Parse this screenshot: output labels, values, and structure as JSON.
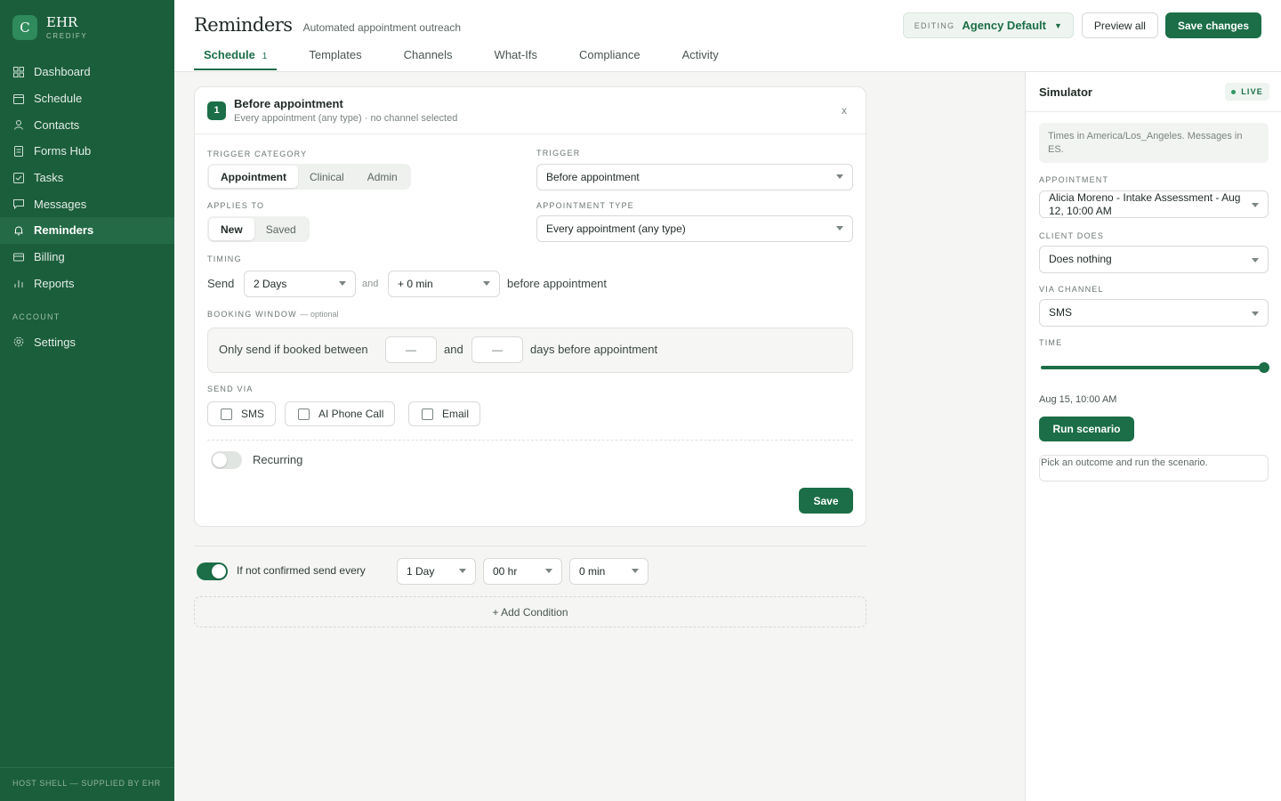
{
  "sidebar": {
    "logo_letter": "C",
    "brand_name": "EHR",
    "brand_sub": "CREDIFY",
    "items": [
      {
        "label": "Dashboard",
        "icon": "grid-icon"
      },
      {
        "label": "Schedule",
        "icon": "calendar-icon"
      },
      {
        "label": "Contacts",
        "icon": "person-icon"
      },
      {
        "label": "Forms Hub",
        "icon": "document-icon"
      },
      {
        "label": "Tasks",
        "icon": "checkbox-icon"
      },
      {
        "label": "Messages",
        "icon": "chat-icon"
      },
      {
        "label": "Reminders",
        "icon": "bell-icon",
        "active": true
      },
      {
        "label": "Billing",
        "icon": "card-icon"
      },
      {
        "label": "Reports",
        "icon": "bar-chart-icon"
      }
    ],
    "account_section": "ACCOUNT",
    "settings_label": "Settings",
    "footer": "HOST SHELL — SUPPLIED BY EHR"
  },
  "header": {
    "title": "Reminders",
    "subtitle": "Automated appointment outreach",
    "tabs": [
      {
        "label": "Schedule",
        "count": "1",
        "active": true
      },
      {
        "label": "Templates"
      },
      {
        "label": "Channels"
      },
      {
        "label": "What-Ifs"
      },
      {
        "label": "Compliance"
      },
      {
        "label": "Activity"
      }
    ],
    "editing_label": "EDITING",
    "editing_value": "Agency Default",
    "preview_label": "Preview all",
    "save_changes_label": "Save changes"
  },
  "rule": {
    "step": "1",
    "title": "Before appointment",
    "subtitle": "Every appointment (any type) · no channel selected",
    "close": "x",
    "trigger_category_label": "TRIGGER CATEGORY",
    "trigger_categories": [
      "Appointment",
      "Clinical",
      "Admin"
    ],
    "trigger_label": "TRIGGER",
    "trigger_value": "Before appointment",
    "applies_to_label": "APPLIES TO",
    "applies_to": [
      "New",
      "Saved"
    ],
    "appointment_type_label": "APPOINTMENT TYPE",
    "appointment_type_value": "Every appointment (any type)",
    "timing_label": "TIMING",
    "timing_send": "Send",
    "timing_days": "2 Days",
    "timing_and": "and",
    "timing_min": "+ 0 min",
    "timing_after": "before appointment",
    "booking_label": "BOOKING WINDOW",
    "booking_optional": "— optional",
    "booking_prefix": "Only send if booked between",
    "booking_from": "—",
    "booking_and": "and",
    "booking_to": "—",
    "booking_suffix": "days before appointment",
    "send_via_label": "SEND VIA",
    "channels": [
      "SMS",
      "AI Phone Call",
      "Email"
    ],
    "recurring_label": "Recurring",
    "save_label": "Save"
  },
  "followup": {
    "label": "If not confirmed send every",
    "days": "1 Day",
    "hours": "00 hr",
    "minutes": "0 min",
    "add_condition": "+ Add Condition"
  },
  "simulator": {
    "title": "Simulator",
    "live": "LIVE",
    "note": "Times in America/Los_Angeles. Messages in ES.",
    "appointment_label": "APPOINTMENT",
    "appointment_value": "Alicia Moreno - Intake Assessment - Aug 12, 10:00 AM",
    "client_does_label": "CLIENT DOES",
    "client_does_value": "Does nothing",
    "via_channel_label": "VIA CHANNEL",
    "via_channel_value": "SMS",
    "time_label": "TIME",
    "time_value": "Aug 15, 10:00 AM",
    "time_slider_position": 1.0,
    "run_label": "Run scenario",
    "result": "Pick an outcome and run the scenario."
  },
  "colors": {
    "brand": "#1b6e47",
    "sidebar": "#1b5e3b",
    "accent_light": "#eef5f0"
  }
}
